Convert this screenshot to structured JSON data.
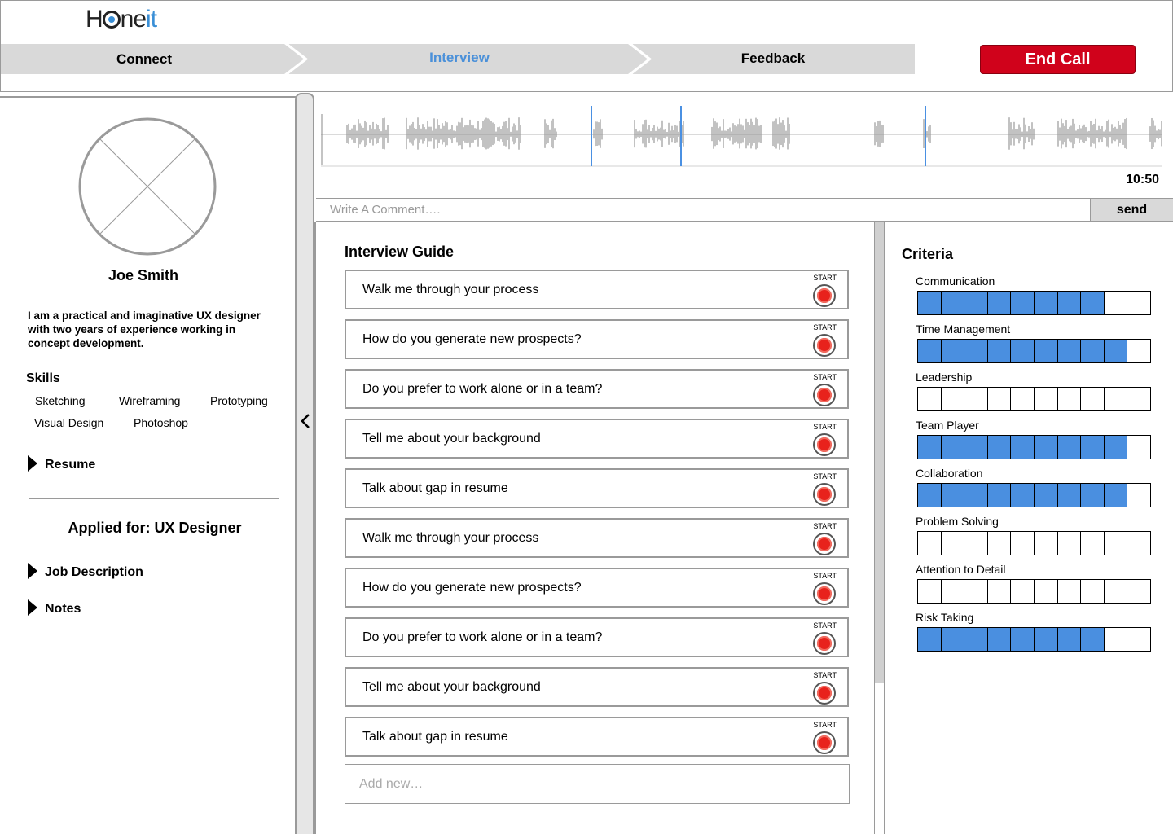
{
  "app": {
    "logo_parts": [
      "H",
      "o",
      "ne",
      "it"
    ]
  },
  "steps": [
    {
      "label": "Connect"
    },
    {
      "label": "Interview"
    },
    {
      "label": "Feedback"
    }
  ],
  "end_call_label": "End Call",
  "profile": {
    "name": "Joe Smith",
    "bio": "I am a practical and imaginative UX designer with two years of experience working in concept development.",
    "skills_title": "Skills",
    "skills": [
      "Sketching",
      "Wireframing",
      "Prototyping",
      "Visual Design",
      "Photoshop"
    ],
    "resume_label": "Resume",
    "applied_for": "Applied for: UX Designer",
    "job_description_label": "Job Description",
    "notes_label": "Notes"
  },
  "recording": {
    "timecode": "10:50"
  },
  "comment": {
    "placeholder": "Write A Comment….",
    "send_label": "send"
  },
  "guide": {
    "title": "Interview Guide",
    "start_label": "START",
    "questions": [
      "Walk me through your process",
      "How do you generate new prospects?",
      "Do you prefer to work alone or in a team?",
      "Tell me about your background",
      "Talk about gap in resume",
      "Walk me through your process",
      "How do you generate new prospects?",
      "Do you prefer to work alone or in a team?",
      "Tell me about your background",
      "Talk about gap in resume"
    ],
    "add_placeholder": "Add new…"
  },
  "criteria": {
    "title": "Criteria",
    "scale_max": 10,
    "items": [
      {
        "label": "Communication",
        "rating": 8
      },
      {
        "label": "Time Management",
        "rating": 9
      },
      {
        "label": "Leadership",
        "rating": 0
      },
      {
        "label": "Team Player",
        "rating": 9
      },
      {
        "label": "Collaboration",
        "rating": 9
      },
      {
        "label": "Problem Solving",
        "rating": 0
      },
      {
        "label": "Attention to Detail",
        "rating": 0
      },
      {
        "label": "Risk Taking",
        "rating": 8
      }
    ]
  },
  "colors": {
    "accent": "#4a90d9",
    "end_call": "#d0021b",
    "rating_fill": "#4a8fe0",
    "record": "#e8221c"
  }
}
